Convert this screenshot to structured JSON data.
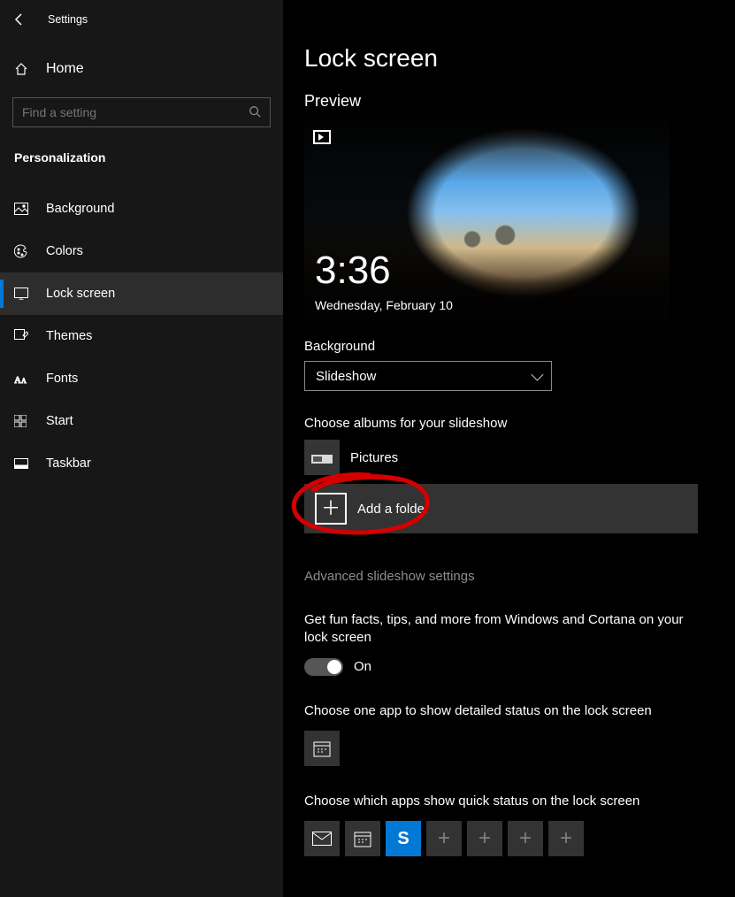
{
  "header": {
    "title": "Settings"
  },
  "sidebar": {
    "home": "Home",
    "search_placeholder": "Find a setting",
    "section": "Personalization",
    "items": [
      {
        "label": "Background"
      },
      {
        "label": "Colors"
      },
      {
        "label": "Lock screen"
      },
      {
        "label": "Themes"
      },
      {
        "label": "Fonts"
      },
      {
        "label": "Start"
      },
      {
        "label": "Taskbar"
      }
    ]
  },
  "main": {
    "title": "Lock screen",
    "preview_heading": "Preview",
    "preview_time": "3:36",
    "preview_date": "Wednesday, February 10",
    "background_label": "Background",
    "background_value": "Slideshow",
    "albums_label": "Choose albums for your slideshow",
    "album_name": "Pictures",
    "add_folder": "Add a folder",
    "advanced_link": "Advanced slideshow settings",
    "fun_facts_text": "Get fun facts, tips, and more from Windows and Cortana on your lock screen",
    "fun_facts_state": "On",
    "detailed_status_label": "Choose one app to show detailed status on the lock screen",
    "quick_status_label": "Choose which apps show quick status on the lock screen"
  }
}
